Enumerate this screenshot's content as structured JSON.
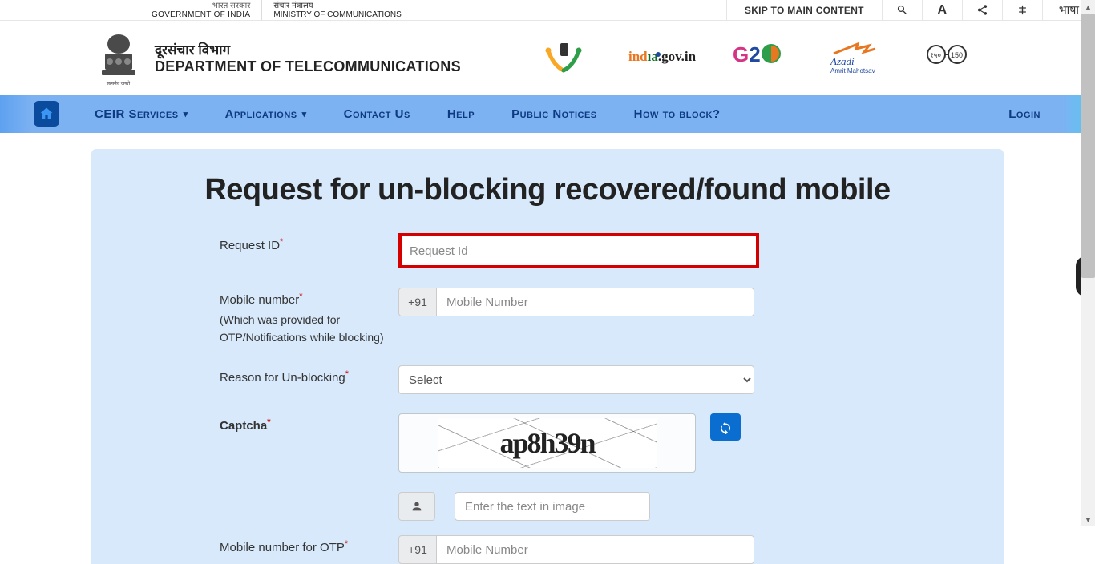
{
  "top": {
    "gov_hi": "भारत सरकार",
    "gov_en": "GOVERNMENT OF INDIA",
    "moc_hi": "संचार मंत्रालय",
    "moc_en": "MINISTRY OF COMMUNICATIONS",
    "skip": "SKIP TO MAIN CONTENT",
    "text_size": "A",
    "lang": "भाषा"
  },
  "dept": {
    "hi": "दूरसंचार विभाग",
    "en": "DEPARTMENT OF TELECOMMUNICATIONS",
    "motto": "सत्यमेव जयते"
  },
  "partner_logos": {
    "sanchar": "SANCHAR SAATHI",
    "india_gov": "india.gov.in",
    "g20": "G20",
    "azadi": "Azadi Ka Amrit Mahotsav",
    "gandhi": "150"
  },
  "nav": {
    "items": [
      {
        "label": "CEIR Services",
        "dropdown": true
      },
      {
        "label": "Applications",
        "dropdown": true
      },
      {
        "label": "Contact Us",
        "dropdown": false
      },
      {
        "label": "Help",
        "dropdown": false
      },
      {
        "label": "Public Notices",
        "dropdown": false
      },
      {
        "label": "How to block?",
        "dropdown": false
      }
    ],
    "login": "Login"
  },
  "form": {
    "title": "Request for un-blocking recovered/found mobile",
    "request_id_label": "Request ID",
    "request_id_placeholder": "Request Id",
    "mobile_label": "Mobile number",
    "mobile_hint": "(Which was provided for OTP/Notifications while blocking)",
    "mobile_prefix": "+91",
    "mobile_placeholder": "Mobile Number",
    "reason_label": "Reason for Un-blocking",
    "reason_selected": "Select",
    "captcha_label": "Captcha",
    "captcha_text": "ap8h39n",
    "captcha_input_placeholder": "Enter the text in image",
    "otp_mobile_label": "Mobile number for OTP",
    "otp_mobile_prefix": "+91",
    "otp_mobile_placeholder": "Mobile Number"
  }
}
